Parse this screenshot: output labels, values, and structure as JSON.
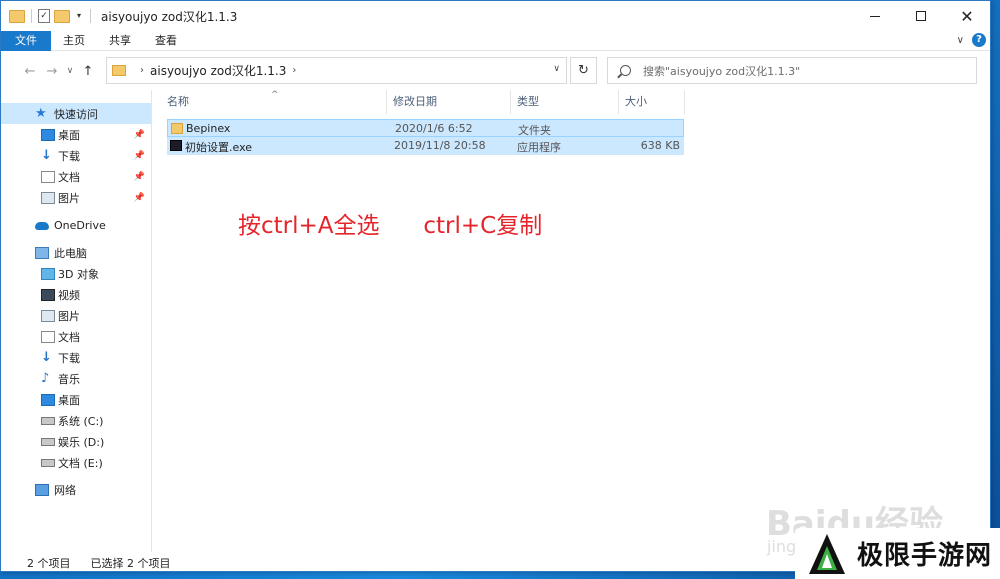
{
  "window": {
    "title": "aisyoujyo zod汉化1.1.3",
    "qat_check": "✓",
    "qat_dropdown": "▾",
    "controls": {
      "minimize": "",
      "maximize": "",
      "close": "✕"
    }
  },
  "ribbon": {
    "tabs": [
      "文件",
      "主页",
      "共享",
      "查看"
    ],
    "collapse": "∨",
    "help": "?"
  },
  "address": {
    "back": "←",
    "forward": "→",
    "recent": "∨",
    "up": "↑",
    "sep1": "›",
    "crumb": "aisyoujyo zod汉化1.1.3",
    "sep2": "›",
    "dropdown": "∨",
    "refresh": "↻",
    "search_placeholder": "搜索\"aisyoujyo zod汉化1.1.3\""
  },
  "nav": {
    "items": [
      {
        "label": "快速访问",
        "icon": "star-icon"
      },
      {
        "label": "桌面",
        "icon": "desktop-icon",
        "pinned": true
      },
      {
        "label": "下载",
        "icon": "download-icon",
        "pinned": true
      },
      {
        "label": "文档",
        "icon": "document-icon",
        "pinned": true
      },
      {
        "label": "图片",
        "icon": "picture-icon",
        "pinned": true
      },
      {
        "label": "OneDrive",
        "icon": "cloud-icon"
      },
      {
        "label": "此电脑",
        "icon": "computer-icon"
      },
      {
        "label": "3D 对象",
        "icon": "3d-objects-icon"
      },
      {
        "label": "视频",
        "icon": "video-icon"
      },
      {
        "label": "图片",
        "icon": "picture-icon"
      },
      {
        "label": "文档",
        "icon": "document-icon"
      },
      {
        "label": "下载",
        "icon": "download-icon"
      },
      {
        "label": "音乐",
        "icon": "music-icon"
      },
      {
        "label": "桌面",
        "icon": "desktop-icon"
      },
      {
        "label": "系统 (C:)",
        "icon": "drive-icon"
      },
      {
        "label": "娱乐 (D:)",
        "icon": "drive-icon"
      },
      {
        "label": "文档 (E:)",
        "icon": "drive-icon"
      },
      {
        "label": "网络",
        "icon": "network-icon"
      }
    ],
    "pin_glyph": "📌"
  },
  "filelist": {
    "sort_glyph": "^",
    "columns": [
      "名称",
      "修改日期",
      "类型",
      "大小"
    ],
    "rows": [
      {
        "name": "Bepinex",
        "date": "2020/1/6 6:52",
        "type": "文件夹",
        "size": "",
        "icon": "folder-icon"
      },
      {
        "name": "初始设置.exe",
        "date": "2019/11/8 20:58",
        "type": "应用程序",
        "size": "638 KB",
        "icon": "exe-icon"
      }
    ]
  },
  "annotation": "按ctrl+A全选      ctrl+C复制",
  "status": {
    "count": "2 个项目",
    "selected": "已选择 2 个项目"
  },
  "watermark": {
    "baidu": "Baidu经验",
    "baidu_sub": "jingyan",
    "site": "极限手游网"
  }
}
